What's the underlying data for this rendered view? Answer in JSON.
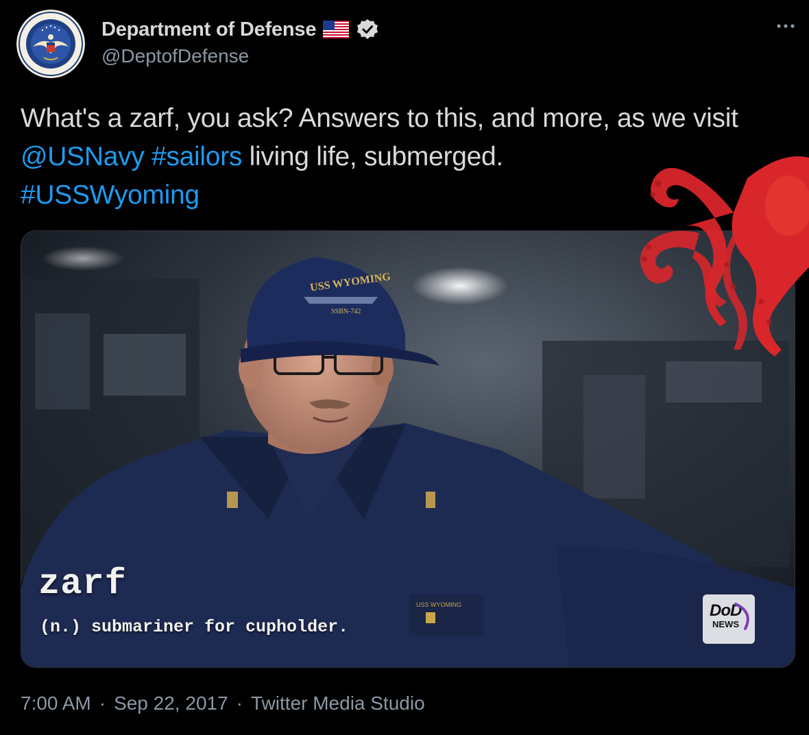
{
  "author": {
    "display_name": "Department of Defense",
    "handle": "@DeptofDefense",
    "avatar_icon": "dod-seal-icon",
    "flag_icon": "us-flag-icon",
    "verified_icon": "verified-badge-icon"
  },
  "menu": {
    "more_icon": "more-options-icon"
  },
  "tweet": {
    "text_part1": "What's a zarf, you ask? Answers to this, and more, as we visit ",
    "mention": "@USNavy",
    "space": " ",
    "hashtag1": "#sailors",
    "text_part2": " living life, submerged.",
    "hashtag2": "#USSWyoming"
  },
  "media": {
    "type": "video",
    "caption_word": "zarf",
    "caption_definition": "(n.) submariner for cupholder.",
    "hat_text": "USS WYOMING",
    "hat_subtext": "SSBN-742",
    "badge_line1": "DoD",
    "badge_line2": "NEWS"
  },
  "footer": {
    "time": "7:00 AM",
    "separator": "·",
    "date": "Sep 22, 2017",
    "source": "Twitter Media Studio"
  },
  "colors": {
    "background": "#000000",
    "text": "#d9d9d9",
    "secondary": "#8b98a5",
    "link": "#1d9bf0",
    "octopus": "#d9262b"
  }
}
